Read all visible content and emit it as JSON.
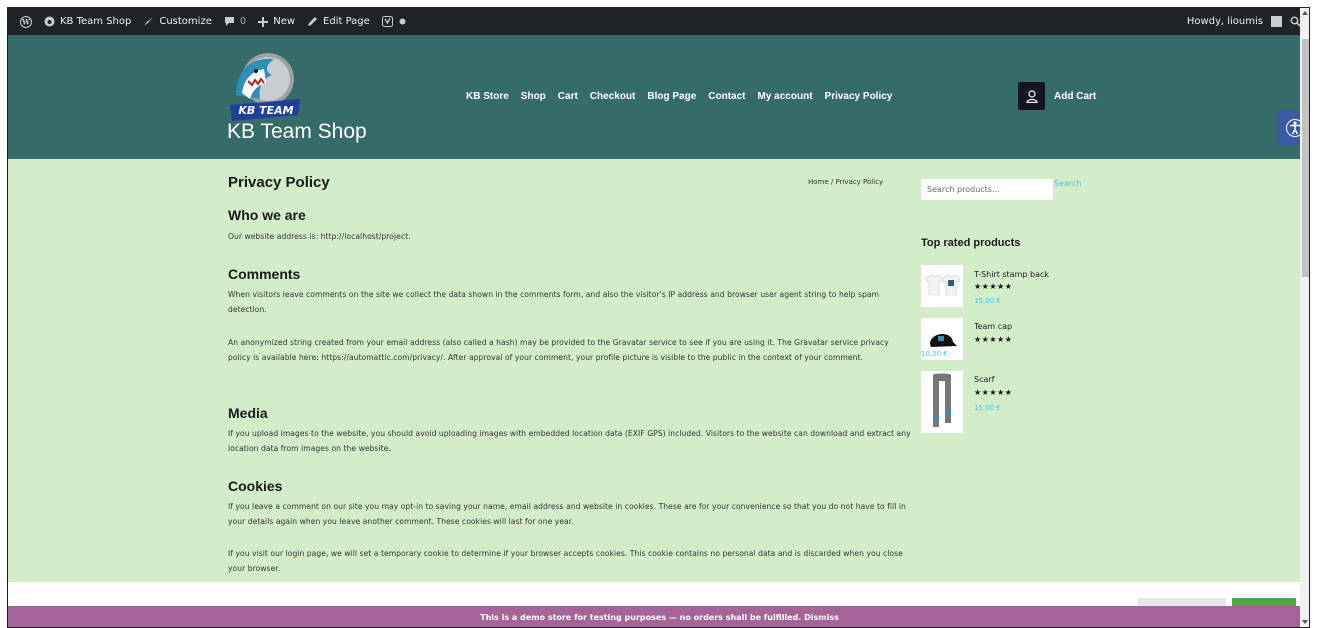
{
  "adminbar": {
    "site_name": "KB Team Shop",
    "customize": "Customize",
    "comments_count": "0",
    "new": "New",
    "edit_page": "Edit Page",
    "greeting": "Howdy, lioumis"
  },
  "header": {
    "logo_text": "KB TEAM",
    "site_title": "KB Team Shop",
    "nav": [
      "KB Store",
      "Shop",
      "Cart",
      "Checkout",
      "Blog Page",
      "Contact",
      "My account",
      "Privacy Policy"
    ],
    "add_cart": "Add Cart"
  },
  "content": {
    "title": "Privacy Policy",
    "breadcrumb": "Home /  Privacy Policy",
    "sections": [
      {
        "heading": "Who we are",
        "paragraphs": [
          "Our website address is: http://localhost/project."
        ]
      },
      {
        "heading": "Comments",
        "paragraphs": [
          "When visitors leave comments on the site we collect the data shown in the comments form, and also the visitor's IP address and browser user agent string to help spam detection.",
          "An anonymized string created from your email address (also called a hash) may be provided to the Gravatar service to see if you are using it. The Gravatar service privacy policy is available here: https://automattic.com/privacy/. After approval of your comment, your profile picture is visible to the public in the context of your comment."
        ]
      },
      {
        "heading": "Media",
        "paragraphs": [
          "If you upload images to the website, you should avoid uploading images with embedded location data (EXIF GPS) included. Visitors to the website can download and extract any location data from images on the website."
        ]
      },
      {
        "heading": "Cookies",
        "paragraphs": [
          "If you leave a comment on our site you may opt-in to saving your name, email address and website in cookies. These are for your convenience so that you do not have to fill in your details again when you leave another comment. These cookies will last for one year.",
          "If you visit our login page, we will set a temporary cookie to determine if your browser accepts cookies. This cookie contains no personal data and is discarded when you close your browser."
        ]
      }
    ]
  },
  "sidebar": {
    "search_placeholder": "Search products...",
    "search_button": "Search",
    "top_rated_title": "Top rated products",
    "products": [
      {
        "name": "T-Shirt stamp back",
        "stars": "★★★★★",
        "price": "15,00 €",
        "rating": 5
      },
      {
        "name": "Team cap",
        "stars": "★★★★★",
        "price": "10,00 €",
        "rating": 5
      },
      {
        "name": "Scarf",
        "stars": "★★★★★",
        "price": "15,00 €",
        "rating": 5
      }
    ]
  },
  "store_notice": "This is a demo store for testing purposes — no orders shall be fulfilled. Dismiss",
  "colors": {
    "header_bg": "#356b69",
    "content_bg": "#d4edc9",
    "admin_bar": "#1d2327",
    "notice_bg": "#a46497",
    "price": "#41c8e8"
  }
}
